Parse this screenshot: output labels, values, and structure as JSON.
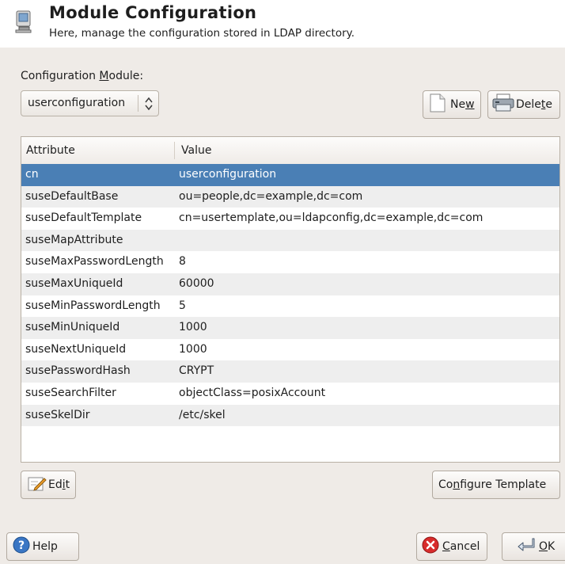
{
  "header": {
    "title": "Module Configuration",
    "subtitle": "Here, manage the configuration stored in LDAP directory."
  },
  "module": {
    "label_pre": "Configuration ",
    "label_key": "M",
    "label_post": "odule:",
    "selected": "userconfiguration"
  },
  "toolbar": {
    "new_pre": "Ne",
    "new_key": "w",
    "new_post": "",
    "delete_pre": "Dele",
    "delete_key": "t",
    "delete_post": "e"
  },
  "table": {
    "columns": [
      "Attribute",
      "Value"
    ],
    "rows": [
      {
        "attr": "cn",
        "value": "userconfiguration",
        "selected": true
      },
      {
        "attr": "suseDefaultBase",
        "value": "ou=people,dc=example,dc=com"
      },
      {
        "attr": "suseDefaultTemplate",
        "value": "cn=usertemplate,ou=ldapconfig,dc=example,dc=com"
      },
      {
        "attr": "suseMapAttribute",
        "value": ""
      },
      {
        "attr": "suseMaxPasswordLength",
        "value": "8"
      },
      {
        "attr": "suseMaxUniqueId",
        "value": "60000"
      },
      {
        "attr": "suseMinPasswordLength",
        "value": "5"
      },
      {
        "attr": "suseMinUniqueId",
        "value": "1000"
      },
      {
        "attr": "suseNextUniqueId",
        "value": "1000"
      },
      {
        "attr": "susePasswordHash",
        "value": "CRYPT"
      },
      {
        "attr": "suseSearchFilter",
        "value": "objectClass=posixAccount"
      },
      {
        "attr": "suseSkelDir",
        "value": "/etc/skel"
      }
    ]
  },
  "actions": {
    "edit_pre": "Ed",
    "edit_key": "i",
    "edit_post": "t",
    "configure_pre": "Co",
    "configure_key": "n",
    "configure_post": "figure Template"
  },
  "footer": {
    "help_label": "Help",
    "cancel_pre": "",
    "cancel_key": "C",
    "cancel_post": "ancel",
    "ok_pre": "",
    "ok_key": "O",
    "ok_post": "K"
  },
  "colors": {
    "selection": "#4a7fb5",
    "window_bg": "#efebe7",
    "alt_row": "#eeeeee"
  }
}
